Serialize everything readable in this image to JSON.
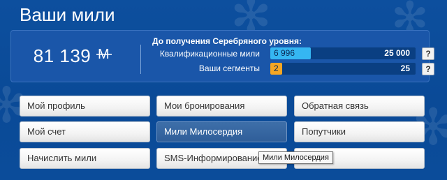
{
  "header": {
    "title": "Ваши мили"
  },
  "miles": {
    "value": "81 139",
    "currency_symbol": "M"
  },
  "progress": {
    "title": "До получения Серебряного уровня:",
    "rows": [
      {
        "label": "Квалификационные мили",
        "current": "6 996",
        "target": "25 000",
        "fraction": 0.28,
        "color": "#35b6f2",
        "help": "?"
      },
      {
        "label": "Ваши сегменты",
        "current": "2",
        "target": "25",
        "fraction": 0.08,
        "color": "#f5a623",
        "help": "?"
      }
    ]
  },
  "menu": {
    "buttons": [
      [
        "Мой профиль",
        "Мои бронирования",
        "Обратная связь"
      ],
      [
        "Мой счет",
        "Мили Милосердия",
        "Попутчики"
      ],
      [
        "Начислить мили",
        "SMS-Информирование",
        ""
      ]
    ]
  },
  "tooltip": {
    "text": "Мили Милосердия"
  }
}
